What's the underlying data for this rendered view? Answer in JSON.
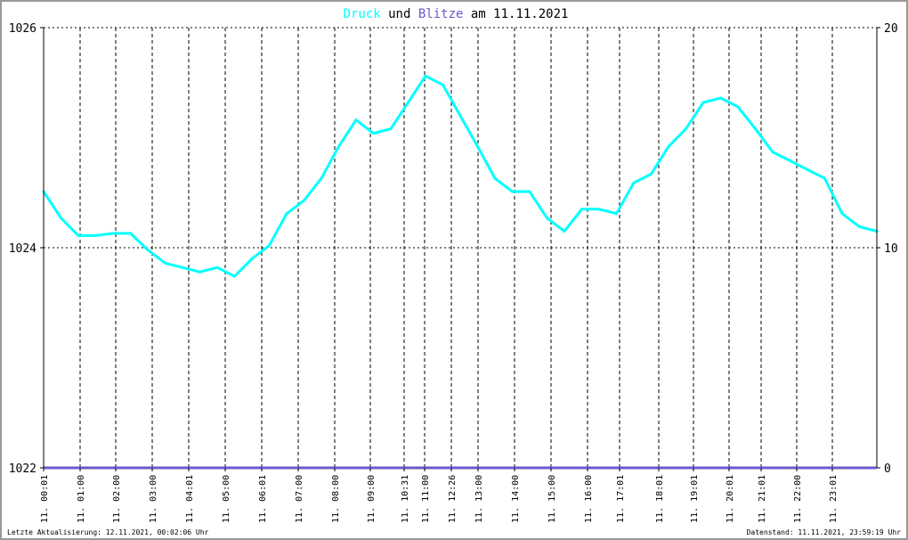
{
  "title": {
    "part1": "Druck",
    "part2": " und ",
    "part3": "Blitze",
    "part4": " am 11.11.2021"
  },
  "colors": {
    "pressure": "#00ffff",
    "lightning": "#6a5acd",
    "grid": "#000000"
  },
  "footer": {
    "left": "Letzte Aktualisierung: 12.11.2021, 00:02:06 Uhr",
    "right": "Datenstand: 11.11.2021, 23:59:19 Uhr"
  },
  "chart_data": {
    "type": "line",
    "title": "Druck und Blitze am 11.11.2021",
    "y_left": {
      "label": "Druck",
      "range": [
        1022,
        1026
      ],
      "ticks": [
        "1026",
        "1024",
        "1022"
      ]
    },
    "y_right": {
      "label": "Blitze",
      "range": [
        0,
        20
      ],
      "ticks": [
        "20",
        "10",
        "0"
      ]
    },
    "x_ticks": [
      "11. 00:01",
      "11. 01:00",
      "11. 02:00",
      "11. 03:00",
      "11. 04:01",
      "11. 05:00",
      "11. 06:01",
      "11. 07:00",
      "11. 08:00",
      "11. 09:00",
      "11. 10:31",
      "11. 11:00",
      "11. 12:26",
      "11. 13:00",
      "11. 14:00",
      "11. 15:00",
      "11. 16:00",
      "11. 17:01",
      "11. 18:01",
      "11. 19:01",
      "11. 20:01",
      "11. 21:01",
      "11. 22:00",
      "11. 23:01"
    ],
    "series": [
      {
        "name": "Druck",
        "axis": "left",
        "x_hours": [
          0,
          0.5,
          1,
          1.5,
          2,
          2.5,
          3,
          3.5,
          4,
          4.5,
          5,
          5.5,
          6,
          6.5,
          7,
          7.5,
          8,
          8.5,
          9,
          9.5,
          10,
          10.5,
          11,
          11.5,
          12,
          12.5,
          13,
          13.5,
          14,
          14.5,
          15,
          15.5,
          16,
          16.5,
          17,
          17.5,
          18,
          18.5,
          19,
          19.5,
          20,
          20.5,
          21,
          21.5,
          22,
          22.5,
          23,
          23.5,
          24
        ],
        "values": [
          1024.51,
          1024.27,
          1024.11,
          1024.11,
          1024.13,
          1024.13,
          1023.98,
          1023.86,
          1023.82,
          1023.78,
          1023.82,
          1023.74,
          1023.9,
          1024.02,
          1024.31,
          1024.43,
          1024.63,
          1024.92,
          1025.16,
          1025.04,
          1025.08,
          1025.32,
          1025.56,
          1025.48,
          1025.2,
          1024.92,
          1024.63,
          1024.51,
          1024.51,
          1024.27,
          1024.15,
          1024.35,
          1024.35,
          1024.31,
          1024.59,
          1024.67,
          1024.92,
          1025.08,
          1025.32,
          1025.36,
          1025.28,
          1025.08,
          1024.87,
          1024.79,
          1024.71,
          1024.63,
          1024.31,
          1024.19,
          1024.15
        ]
      },
      {
        "name": "Blitze",
        "axis": "right",
        "x_hours": [
          0,
          24
        ],
        "values": [
          0,
          0
        ]
      }
    ],
    "grid": true
  }
}
